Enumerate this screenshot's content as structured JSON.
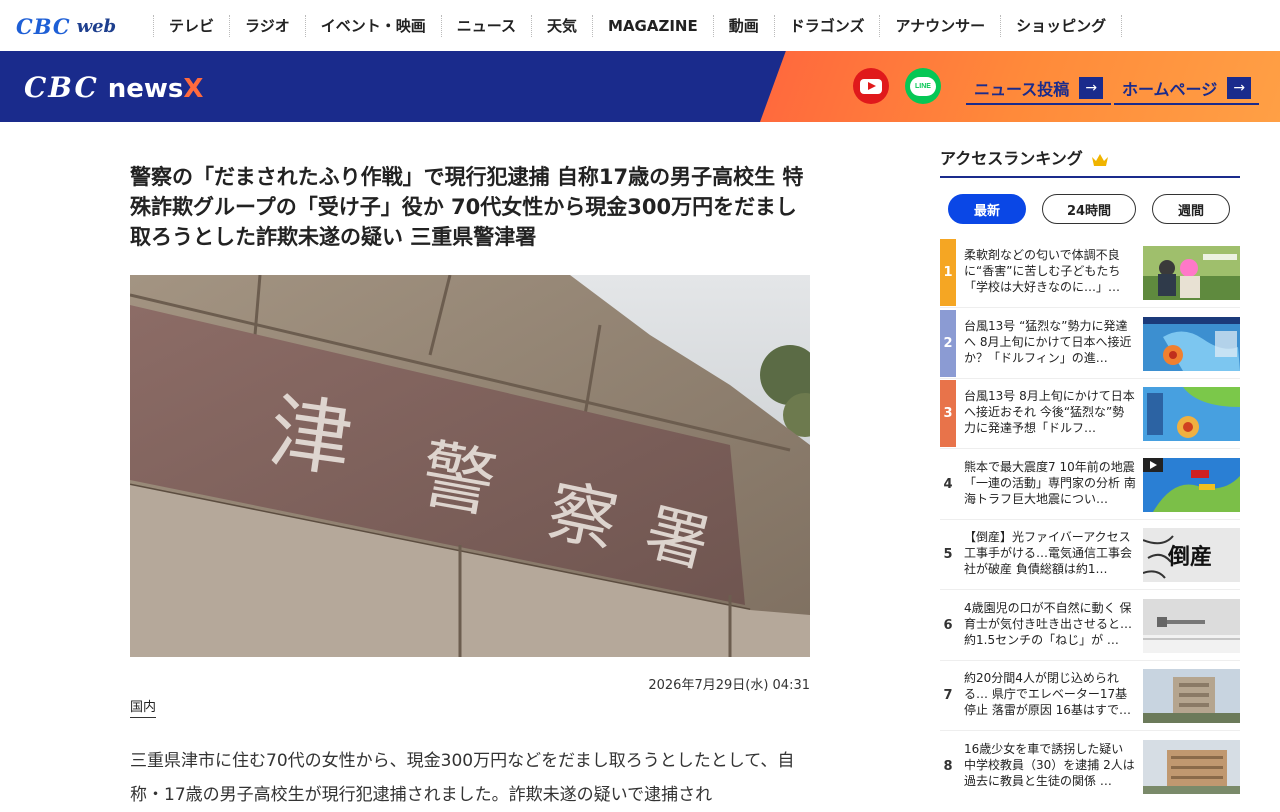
{
  "topnav": {
    "logo_main": "CBC",
    "logo_sub": "web",
    "items": [
      "テレビ",
      "ラジオ",
      "イベント・映画",
      "ニュース",
      "天気",
      "MAGAZINE",
      "動画",
      "ドラゴンズ",
      "アナウンサー",
      "ショッピング"
    ]
  },
  "banner": {
    "logo_cbc": "CBC",
    "logo_news": "news",
    "logo_x": "X",
    "youtube_icon": "youtube-icon",
    "line_icon": "line-icon",
    "line_text": "LINE",
    "news_post": "ニュース投稿",
    "homepage": "ホームページ",
    "arrow": "→"
  },
  "article": {
    "title": "警察の「だまされたふり作戦」で現行犯逮捕 自称17歳の男子高校生 特殊詐欺グループの「受け子」役か 70代女性から現金300万円をだまし取ろうとした詐欺未遂の疑い 三重県警津署",
    "image_text_1": "津",
    "image_text_2": "警",
    "image_text_3": "察",
    "image_text_4": "署",
    "date": "2026年7月29日(水) 04:31",
    "category": "国内",
    "body": "三重県津市に住む70代の女性から、現金300万円などをだまし取ろうとしたとして、自称・17歳の男子高校生が現行犯逮捕されました。詐欺未遂の疑いで逮捕され"
  },
  "ranking": {
    "title": "アクセスランキング",
    "tabs": [
      "最新",
      "24時間",
      "週間"
    ],
    "items": [
      {
        "rank": "1",
        "text": "柔軟剤などの匂いで体調不良に“香害”に苦しむ子どもたち「学校は大好きなのに…」…",
        "color": "#f5a623"
      },
      {
        "rank": "2",
        "text": "台風13号 “猛烈な”勢力に発達へ 8月上旬にかけて日本へ接近か？「ドルフィン」の進…",
        "color": "#8b9bd3"
      },
      {
        "rank": "3",
        "text": "台風13号 8月上旬にかけて日本へ接近おそれ 今後“猛烈な”勢力に発達予想「ドルフ…",
        "color": "#e8734a"
      },
      {
        "rank": "4",
        "text": "熊本で最大震度7 10年前の地震「一連の活動」専門家の分析 南海トラフ巨大地震につい…",
        "color": ""
      },
      {
        "rank": "5",
        "text": "【倒産】光ファイバーアクセス工事手がける…電気通信工事会社が破産 負債総額は約1…",
        "color": "",
        "thumb_text": "倒産"
      },
      {
        "rank": "6",
        "text": "4歳園児の口が不自然に動く 保育士が気付き吐き出させると…約1.5センチの「ねじ」が …",
        "color": ""
      },
      {
        "rank": "7",
        "text": "約20分間4人が閉じ込められる… 県庁でエレベーター17基停止 落雷が原因 16基はすで…",
        "color": ""
      },
      {
        "rank": "8",
        "text": "16歳少女を車で誘拐した疑い 中学校教員（30）を逮捕 2人は過去に教員と生徒の関係 …",
        "color": ""
      }
    ]
  },
  "colors": {
    "navy": "#1a2b8c",
    "orange": "#ff6a3d",
    "active_tab": "#0a47e6"
  }
}
